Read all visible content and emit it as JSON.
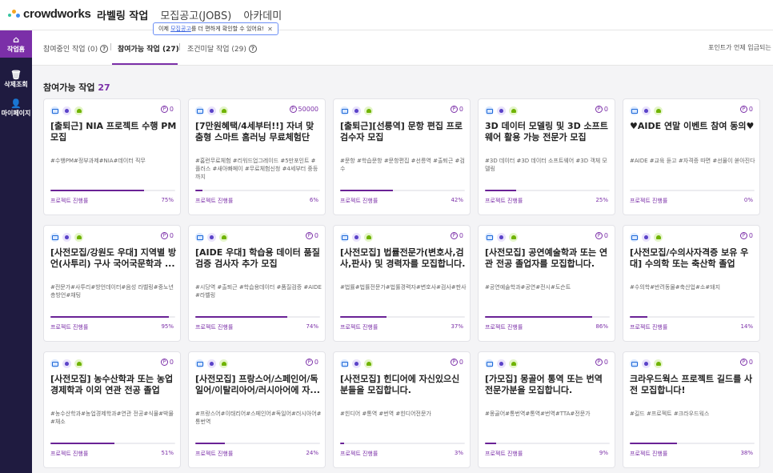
{
  "header": {
    "logo_text": "crowdworks",
    "nav": [
      "라벨링 작업",
      "모집공고(JOBS)",
      "아카데미"
    ],
    "tooltip": {
      "prefix": "이제 ",
      "highlight": "모집공고",
      "suffix": "를 더 편하게 확인할 수 있어요!",
      "close": "✕"
    }
  },
  "sidebar": {
    "items": [
      {
        "icon": "home-icon",
        "glyph": "⌂",
        "label": "작업홈"
      },
      {
        "icon": "trash-icon",
        "glyph": "🗑",
        "label": "삭제조회"
      },
      {
        "icon": "user-icon",
        "glyph": "👤",
        "label": "마이페이지"
      }
    ]
  },
  "tabs": {
    "items": [
      "참여중인 작업 (0)",
      "참여가능 작업 (27)",
      "조건미달 작업 (29)"
    ],
    "help_glyph": "?",
    "separator": "|",
    "point_note": "포인트가 언제 입금되는"
  },
  "section": {
    "title": "참여가능 작업",
    "count": "27"
  },
  "progress_label": "프로젝트 진행률",
  "point_glyph": "P",
  "cards": [
    {
      "points": "0",
      "title": "[출퇴근] NIA 프로젝트 수행 PM 모집",
      "tags": "#수행PM#정부과제#NIA#데이터 직무",
      "progress": 75,
      "progress_text": "75%"
    },
    {
      "points": "50000",
      "title": "[7만원혜택/4세부터!!] 자녀 맞춤형 스마트 홈러닝 무료체험단 모...",
      "tags": "#홈런무료체험 #리워드업그레이드 #5만포인트 # 플러스 #새아빠페이 #무료체험신청 #4세부터 중등까지",
      "progress": 6,
      "progress_text": "6%"
    },
    {
      "points": "0",
      "title": "[출퇴근][선릉역] 문항 편집 프로 검수자 모집",
      "tags": "#문항 #학습문항 #문항편집 #선릉역 #출퇴근 #검수",
      "progress": 42,
      "progress_text": "42%"
    },
    {
      "points": "0",
      "title": "3D 데이터 모델링 및 3D 소프트웨어 활용 가능 전문가 모집",
      "tags": "#3D 데이터 #3D 데이터 소프트웨어 #3D 객체 모델링",
      "progress": 25,
      "progress_text": "25%"
    },
    {
      "points": "0",
      "title": "♥AIDE 연말 이벤트 참여 동의♥",
      "tags": "#AIDE #교육 듣고 #자격증 따면 #선물이 쏟아진다",
      "progress": 0,
      "progress_text": "0%"
    },
    {
      "points": "0",
      "title": "[사전모집/강원도 우대] 지역별 방언(사투리) 구사 국어국문학과 ...",
      "tags": "#전문가#사투리#방언데이터#음성 라벨링#중노년층방언#채팅",
      "progress": 95,
      "progress_text": "95%"
    },
    {
      "points": "0",
      "title": "[AIDE 우대] 학습용 데이터 품질 검증 검사자 추가 모집",
      "tags": "#시당역 #출퇴근 #학습용데이터 #품질검증 #AIDE #라벨링",
      "progress": 74,
      "progress_text": "74%"
    },
    {
      "points": "0",
      "title": "[사전모집] 법률전문가(변호사,검사,판사) 및 경력자를 모집합니다.",
      "tags": "#법률#법률전문가#법률경력자#변호사#검사#판사",
      "progress": 37,
      "progress_text": "37%"
    },
    {
      "points": "0",
      "title": "[사전모집] 공연예술학과 또는 연관 전공 졸업자를 모집합니다.",
      "tags": "#공연예술학과#공연#전시#도슨트",
      "progress": 86,
      "progress_text": "86%"
    },
    {
      "points": "0",
      "title": "[사전모집/수의사자격증 보유 우대] 수의학 또는 축산학 졸업자/...",
      "tags": "#수의학#반려동물#축산업#소#돼지",
      "progress": 14,
      "progress_text": "14%"
    },
    {
      "points": "0",
      "title": "[사전모집] 농수산학과 또는 농업경제학과 이외 연관 전공 졸업자...",
      "tags": "#농수산학과#농업경제학과#연관 전공#식물#박물#채소",
      "progress": 51,
      "progress_text": "51%"
    },
    {
      "points": "0",
      "title": "[사전모집] 프랑스어/스페인어/독일어/이탈리아어/러시아어에 자...",
      "tags": "#프랑스어#이태리어#스페인어#독일어#러시아어#통번역",
      "progress": 24,
      "progress_text": "24%"
    },
    {
      "points": "0",
      "title": "[사전모집] 힌디어에 자신있으신 분들을 모집합니다.",
      "tags": "#힌디어 #통역 #번역 #힌디어전문가",
      "progress": 3,
      "progress_text": "3%"
    },
    {
      "points": "0",
      "title": "[가모집] 몽골어 통역 또는 번역 전문가분을 모집합니다.",
      "tags": "#몽골어#통번역#통역#번역#TTA#전문가",
      "progress": 9,
      "progress_text": "9%"
    },
    {
      "points": "0",
      "title": "크라우드웍스 프로젝트 길드를 사전 모집합니다!",
      "tags": "#길드 #프로젝트 #크라우드웍스",
      "progress": 38,
      "progress_text": "38%"
    }
  ]
}
